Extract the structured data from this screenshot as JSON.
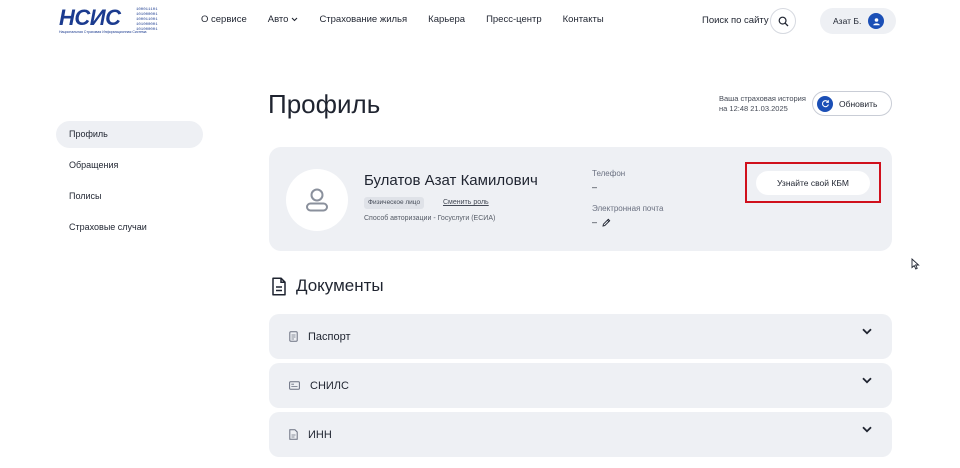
{
  "header": {
    "logo_text": "НСИС",
    "logo_bits": [
      "100011101",
      "101000001",
      "100011001",
      "101000001",
      "101000001"
    ],
    "logo_subtitle": "Национальная Страховая Информационная Система",
    "nav": [
      {
        "label": "О сервисе"
      },
      {
        "label": "Авто"
      },
      {
        "label": "Страхование жилья"
      },
      {
        "label": "Карьера"
      },
      {
        "label": "Пресс-центр"
      },
      {
        "label": "Контакты"
      }
    ],
    "search_label": "Поиск по сайту",
    "user_name": "Азат Б."
  },
  "sidebar": {
    "items": [
      {
        "label": "Профиль",
        "active": true
      },
      {
        "label": "Обращения"
      },
      {
        "label": "Полисы"
      },
      {
        "label": "Страховые случаи"
      }
    ]
  },
  "main": {
    "title": "Профиль",
    "history_line1": "Ваша страховая история",
    "history_line2": "на 12:48 21.03.2025",
    "refresh_label": "Обновить"
  },
  "profile": {
    "full_name": "Булатов Азат Камилович",
    "role": "Физическое лицо",
    "change_role": "Сменить роль",
    "auth_method": "Способ авторизации - Госуслуги (ЕСИА)",
    "phone_label": "Телефон",
    "phone_value": "–",
    "email_label": "Электронная почта",
    "email_value": "–",
    "kbm_button": "Узнайте свой КБМ"
  },
  "documents": {
    "title": "Документы",
    "items": [
      {
        "label": "Паспорт",
        "icon": "passport-icon"
      },
      {
        "label": "СНИЛС",
        "icon": "snils-card-icon"
      },
      {
        "label": "ИНН",
        "icon": "inn-doc-icon"
      }
    ]
  },
  "colors": {
    "brand": "#1b3b8f",
    "accent": "#1b4fb6",
    "card_bg": "#eef0f4",
    "highlight": "#d0101c"
  }
}
